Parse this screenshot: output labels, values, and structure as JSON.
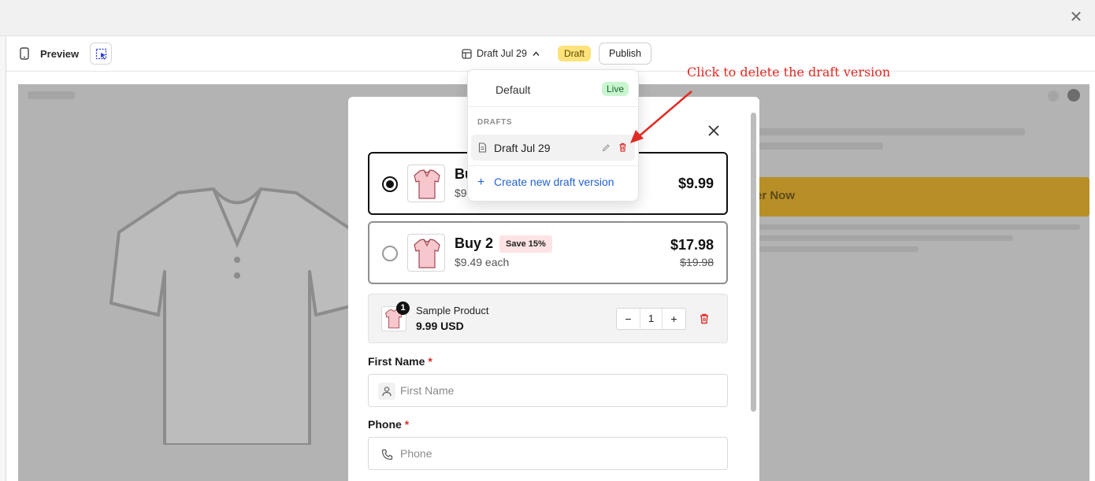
{
  "window": {
    "close_icon": "close-icon"
  },
  "toolbar": {
    "preview_label": "Preview",
    "version_label": "Draft Jul 29",
    "status_badge": "Draft",
    "publish_label": "Publish"
  },
  "canvas": {
    "order_button_text": "er Now"
  },
  "modal": {
    "offers": [
      {
        "title": "Bu",
        "subtitle": "$9",
        "price": "$9.99",
        "selected": true
      },
      {
        "title": "Buy 2",
        "badge": "Save 15%",
        "subtitle": "$9.49 each",
        "price": "$17.98",
        "old_price": "$19.98",
        "selected": false
      }
    ],
    "cart": {
      "product_name": "Sample Product",
      "price": "9.99 USD",
      "quantity": "1",
      "badge_count": "1"
    },
    "fields": [
      {
        "label": "First Name",
        "required_mark": "*",
        "placeholder": "First Name",
        "icon": "user-icon"
      },
      {
        "label": "Phone",
        "required_mark": "*",
        "placeholder": "Phone",
        "icon": "phone-icon"
      }
    ]
  },
  "version_menu": {
    "default_label": "Default",
    "live_badge": "Live",
    "drafts_heading": "DRAFTS",
    "draft_item": "Draft Jul 29",
    "create_label": "Create new draft version"
  },
  "annotation": {
    "text": "Click to delete the draft version",
    "color": "#e02a24"
  },
  "colors": {
    "draft_badge": "#ffe27a",
    "live_badge": "#c9f5cf",
    "link": "#2462d6",
    "delete": "#d9302c"
  }
}
